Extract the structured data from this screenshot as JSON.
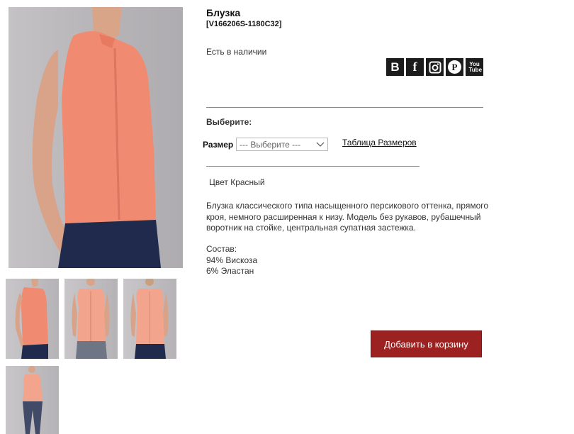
{
  "product": {
    "title": "Блузка",
    "sku": "[V166206S-1180C32]",
    "availability": "Есть в наличии",
    "choose_label": "Выберите:",
    "color_text": "Цвет Красный",
    "description": "Блузка классического типа насыщенного персикового оттенка, прямого кроя, немного расширенная к низу. Модель без рукавов, рубашечный воротник на стойке, центральная супатная застежка.",
    "composition": {
      "label": "Состав:",
      "items": [
        "94% Вискоза",
        "6% Эластан"
      ]
    }
  },
  "size": {
    "label": "Размер",
    "select_value": "--- Выберите ---",
    "size_table_link": "Таблица Размеров"
  },
  "social": [
    {
      "name": "vk-icon",
      "glyph": "B"
    },
    {
      "name": "facebook-icon",
      "glyph": "f"
    },
    {
      "name": "instagram-icon",
      "glyph": ""
    },
    {
      "name": "pinterest-icon",
      "glyph": "P"
    },
    {
      "name": "youtube-icon",
      "glyph": "You Tube"
    }
  ],
  "cart": {
    "button_label": "Добавить в корзину"
  },
  "colors": {
    "blouse": "#f1896f",
    "cart_button": "#9b2220",
    "pants": "#1f2a4d"
  }
}
